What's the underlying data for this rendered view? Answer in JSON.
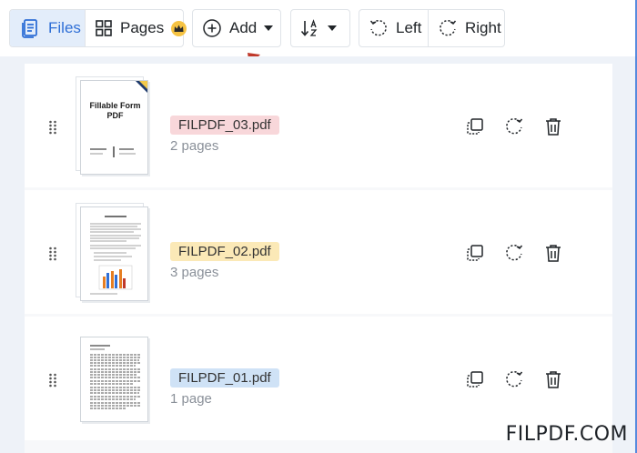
{
  "toolbar": {
    "files_label": "Files",
    "pages_label": "Pages",
    "add_label": "Add",
    "rotate_left_label": "Left",
    "rotate_right_label": "Right",
    "sort_icon": "sort-az-icon"
  },
  "files": [
    {
      "name": "FILPDF_03.pdf",
      "pages": "2 pages",
      "badge_color": "#f8d7da",
      "thumb_title": "Fillable Form PDF"
    },
    {
      "name": "FILPDF_02.pdf",
      "pages": "3 pages",
      "badge_color": "#fbe9b7"
    },
    {
      "name": "FILPDF_01.pdf",
      "pages": "1 page",
      "badge_color": "#cfe2f6"
    }
  ],
  "watermark": "FILPDF.COM",
  "colors": {
    "accent": "#2f6fd6",
    "arrow": "#c0392b",
    "crown": "#f6c343"
  }
}
